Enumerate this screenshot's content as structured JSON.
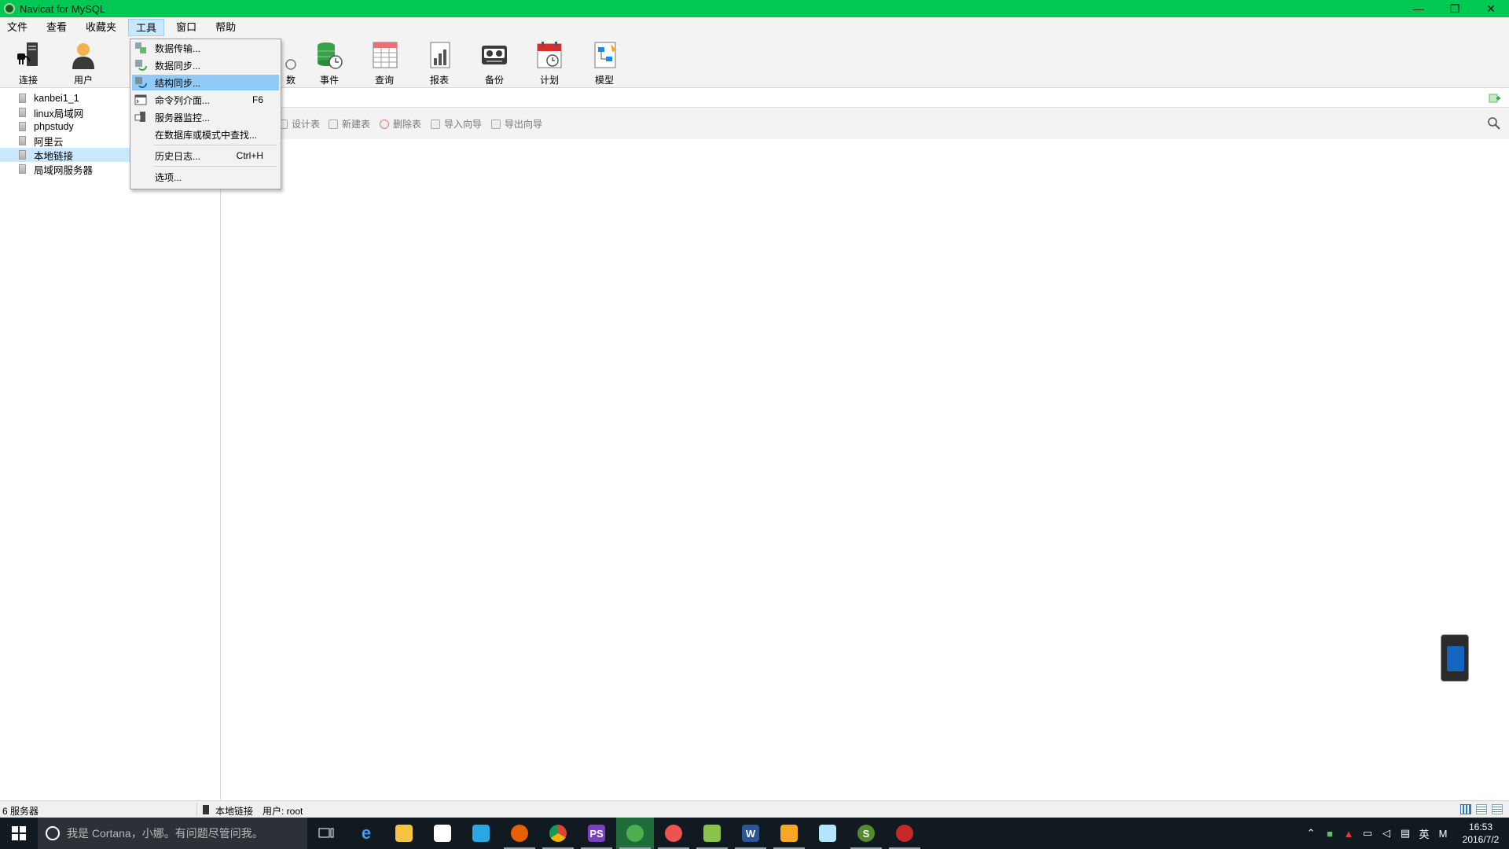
{
  "window": {
    "title": "Navicat for MySQL",
    "controls": [
      "—",
      "❐",
      "✕"
    ]
  },
  "menubar": {
    "items": [
      {
        "label": "文件"
      },
      {
        "label": "查看"
      },
      {
        "label": "收藏夹"
      },
      {
        "label": "工具",
        "active": true
      },
      {
        "label": "窗口"
      },
      {
        "label": "帮助"
      }
    ]
  },
  "toolbar": {
    "connect": "连接",
    "user": "用户",
    "partial": "数",
    "event": "事件",
    "query": "查询",
    "report": "报表",
    "backup": "备份",
    "schedule": "计划",
    "model": "模型"
  },
  "sidebar": {
    "items": [
      {
        "label": "kanbei1_1"
      },
      {
        "label": "linux局域网"
      },
      {
        "label": "phpstudy"
      },
      {
        "label": "阿里云"
      },
      {
        "label": "本地链接",
        "selected": true
      },
      {
        "label": "局域网服务器"
      }
    ]
  },
  "tools_menu": {
    "data_transfer": "数据传输...",
    "data_sync": "数据同步...",
    "structure_sync": "结构同步...",
    "command_line": "命令列介面...",
    "command_line_shortcut": "F6",
    "server_monitor": "服务器监控...",
    "find_in_db": "在数据库或模式中查找...",
    "history_log": "历史日志...",
    "history_log_shortcut": "Ctrl+H",
    "options": "选项..."
  },
  "object_toolbar": {
    "design_table": "设计表",
    "new_table": "新建表",
    "delete_table": "删除表",
    "import_wizard": "导入向导",
    "export_wizard": "导出向导"
  },
  "statusbar": {
    "server_count": "6 服务器",
    "connection": "本地链接",
    "user": "用户: root"
  },
  "taskbar": {
    "cortana_placeholder": "我是 Cortana，小娜。有问题尽管问我。",
    "ime": "英",
    "ime2": "M",
    "time": "16:53",
    "date": "2016/7/2"
  },
  "colors": {
    "title_bar": "#00c853",
    "menu_highlight": "#91c9f7",
    "selection": "#cce8ff",
    "taskbar": "#101a20"
  }
}
